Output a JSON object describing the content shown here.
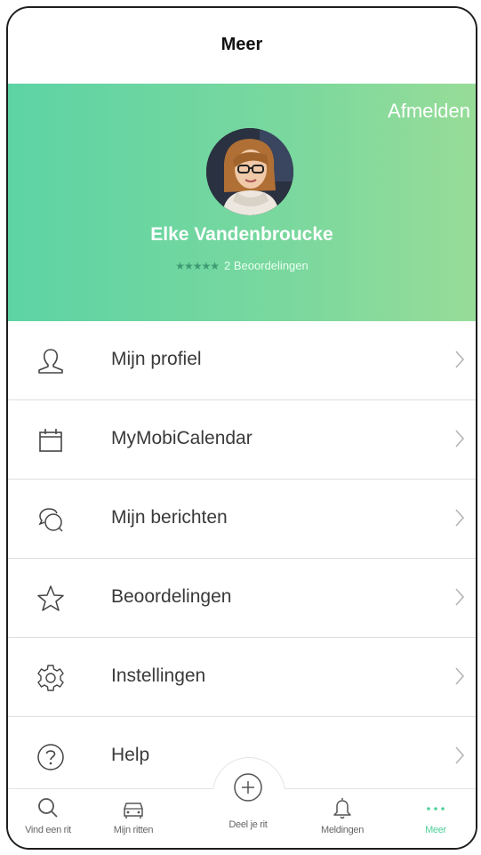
{
  "header": {
    "title": "Meer"
  },
  "profile": {
    "logout_label": "Afmelden",
    "name": "Elke Vandenbroucke",
    "stars": "★★★★★",
    "reviews_label": "2 Beoordelingen"
  },
  "menu": {
    "items": [
      {
        "label": "Mijn profiel",
        "icon": "user-icon"
      },
      {
        "label": "MyMobiCalendar",
        "icon": "calendar-icon"
      },
      {
        "label": "Mijn berichten",
        "icon": "chat-icon"
      },
      {
        "label": "Beoordelingen",
        "icon": "star-icon"
      },
      {
        "label": "Instellingen",
        "icon": "gear-icon"
      },
      {
        "label": "Help",
        "icon": "help-icon"
      }
    ]
  },
  "tabs": [
    {
      "label": "Vind een rit",
      "icon": "search-icon"
    },
    {
      "label": "Mijn ritten",
      "icon": "car-icon"
    },
    {
      "label": "Deel je rit",
      "icon": "plus-circle-icon"
    },
    {
      "label": "Meldingen",
      "icon": "bell-icon"
    },
    {
      "label": "Meer",
      "icon": "more-dots-icon",
      "active": true
    }
  ],
  "colors": {
    "accent": "#4fd09a",
    "gradient_start": "#5dd3a4",
    "gradient_end": "#97dc98"
  }
}
